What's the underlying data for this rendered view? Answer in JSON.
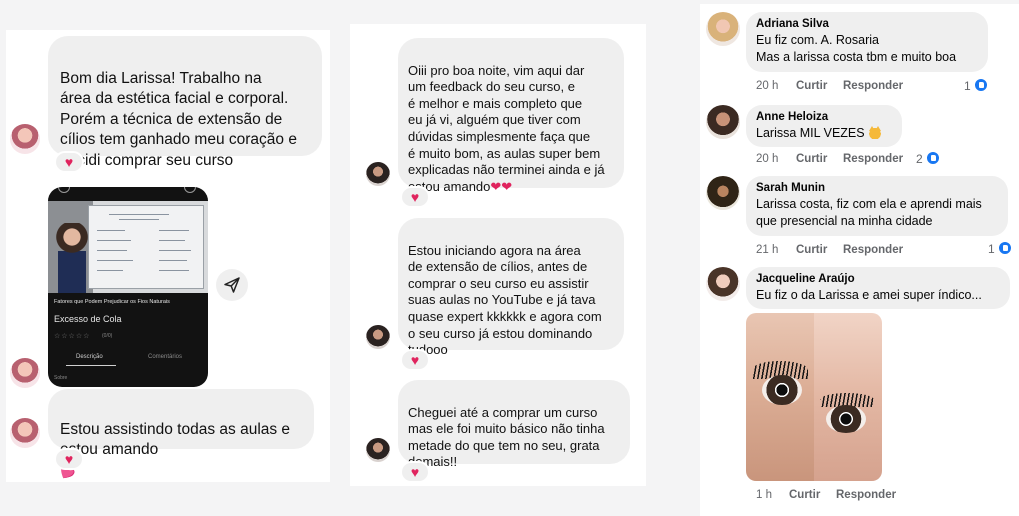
{
  "ig_left": {
    "messages": [
      {
        "text": "Bom dia Larissa! Trabalho na\nárea da estética facial e corporal.\nPorém a técnica de extensão de\ncílios tem ganhado meu coração e\ndecidi comprar seu curso"
      },
      {
        "text": "Estou assistindo todas as aulas e\nestou amando",
        "emoji": "💕"
      }
    ],
    "reaction": "♥",
    "video_card": {
      "caption": "Fatores que Podem Prejudicar os Fios Naturais",
      "title": "Excesso de Cola",
      "stars": "☆☆☆☆☆",
      "stars_count": "(0/0)",
      "tab_description": "Descrição",
      "tab_comments": "Comentários",
      "more": "Sobre"
    },
    "share_icon": "paper-plane-icon"
  },
  "ig_middle": {
    "messages": [
      {
        "text": "Oiii pro boa noite, vim aqui dar\num feedback do seu curso, e\né melhor e mais completo que\neu já vi, alguém que tiver com\ndúvidas simplesmente faça que\né muito bom, as aulas super bem\nexplicadas não terminei ainda e já\nestou amando",
        "emoji": "❤❤"
      },
      {
        "text": "Estou iniciando agora na área\nde extensão de cílios, antes de\ncomprar o seu curso eu assistir\nsuas aulas no YouTube e já tava\nquase expert kkkkkk e agora com\no seu curso já estou dominando\ntudooo"
      },
      {
        "text": "Cheguei até a comprar um curso\nmas ele foi muito básico não tinha\nmetade do que tem no seu, grata\ndemais!!"
      }
    ],
    "reaction": "♥"
  },
  "fb_comments": {
    "items": [
      {
        "name": "Adriana Silva",
        "text": "Eu fiz com. A. Rosaria\nMas a larissa costa tbm e muito boa",
        "time": "20 h",
        "like": "Curtir",
        "reply": "Responder",
        "likes": "1"
      },
      {
        "name": "Anne Heloiza",
        "text": "Larissa MIL VEZES",
        "time": "20 h",
        "like": "Curtir",
        "reply": "Responder",
        "likes": "2"
      },
      {
        "name": "Sarah Munin",
        "text": "Larissa costa, fiz com ela e aprendi mais\nque presencial na minha cidade",
        "time": "21 h",
        "like": "Curtir",
        "reply": "Responder",
        "likes": "1"
      },
      {
        "name": "Jacqueline Araújo",
        "text": "Eu fiz o da Larissa e amei super índico...",
        "time": "1 h",
        "like": "Curtir",
        "reply": "Responder"
      }
    ]
  },
  "colors": {
    "bubble": "#efefef",
    "heart": "#e0245e",
    "fb_like": "#1877f2",
    "meta_text": "#65676b"
  }
}
